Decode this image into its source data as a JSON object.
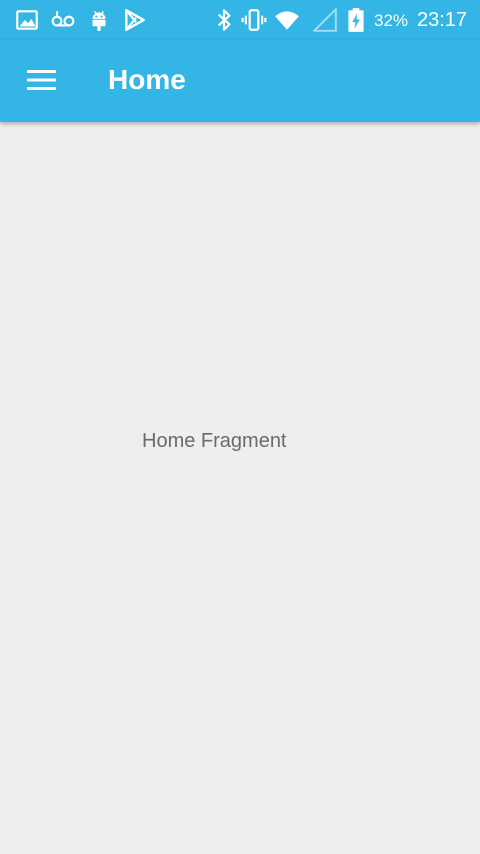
{
  "status_bar": {
    "notification_icons": [
      "gallery-icon",
      "voicemail-icon",
      "android-icon",
      "play-store-icon"
    ],
    "system_icons": [
      "bluetooth-icon",
      "vibrate-icon",
      "wifi-icon",
      "cell-signal-icon",
      "battery-charging-icon"
    ],
    "battery_percent": "32%",
    "time": "23:17"
  },
  "app_bar": {
    "menu_icon": "hamburger-menu-icon",
    "title": "Home"
  },
  "content": {
    "text": "Home Fragment"
  },
  "colors": {
    "primary": "#33b5e5",
    "background": "#eeeeee",
    "body_text": "#6b6b6b"
  }
}
